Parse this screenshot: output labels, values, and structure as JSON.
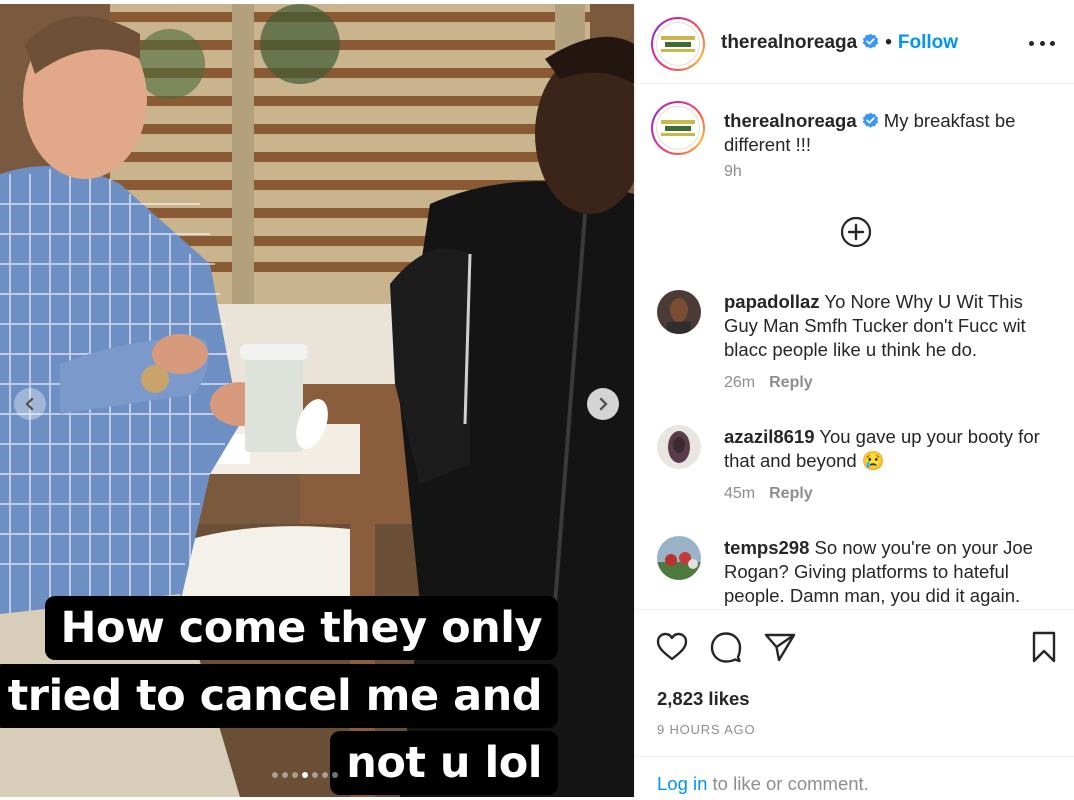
{
  "post": {
    "username": "therealnoreaga",
    "follow_label": "Follow",
    "separator": "•",
    "caption_text": "My breakfast be different !!!",
    "caption_time": "9h",
    "likes": "2,823 likes",
    "time_ago": "9 HOURS AGO",
    "login_link": "Log in",
    "login_rest": " to like or comment."
  },
  "media": {
    "overlay_lines": [
      "How come they only",
      "tried to cancel me and",
      "not u lol"
    ],
    "carousel_dots": 7,
    "active_dot_index": 3
  },
  "comments": [
    {
      "username": "papadollaz",
      "text": "Yo Nore Why U Wit This Guy Man Smfh Tucker don't Fucc wit blacc people like u think he do.",
      "time": "26m",
      "reply": "Reply"
    },
    {
      "username": "azazil8619",
      "text": "You gave up your booty for that and beyond 😢",
      "time": "45m",
      "reply": "Reply"
    },
    {
      "username": "temps298",
      "text": "So now you're on your Joe Rogan? Giving platforms to hateful people. Damn man, you did it again.",
      "time": "",
      "reply": ""
    }
  ],
  "icons": {
    "verified": "verified-badge-icon",
    "more": "more-options-icon",
    "load_more": "plus-circle-icon",
    "like": "heart-icon",
    "comment": "comment-bubble-icon",
    "share": "paper-plane-icon",
    "save": "bookmark-icon",
    "prev": "chevron-left-icon",
    "next": "chevron-right-icon"
  },
  "colors": {
    "link_blue": "#0095f6",
    "verified_blue": "#3897f0",
    "muted_text": "#8e8e8e",
    "text": "#262626"
  }
}
